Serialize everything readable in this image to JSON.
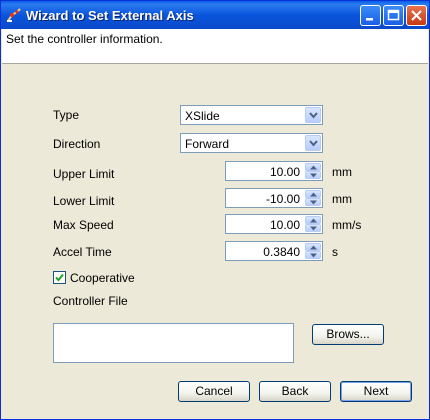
{
  "window": {
    "title": "Wizard to Set External Axis"
  },
  "info": {
    "text": "Set the controller information."
  },
  "form": {
    "type": {
      "label": "Type",
      "value": "XSlide"
    },
    "direction": {
      "label": "Direction",
      "value": "Forward"
    },
    "upper_limit": {
      "label": "Upper Limit",
      "value": "10.00",
      "unit": "mm"
    },
    "lower_limit": {
      "label": "Lower Limit",
      "value": "-10.00",
      "unit": "mm"
    },
    "max_speed": {
      "label": "Max Speed",
      "value": "10.00",
      "unit": "mm/s"
    },
    "accel_time": {
      "label": "Accel Time",
      "value": "0.3840",
      "unit": "s"
    },
    "cooperative": {
      "label": "Cooperative",
      "checked": true
    },
    "controller_file": {
      "label": "Controller File",
      "value": ""
    }
  },
  "buttons": {
    "browse": "Brows...",
    "cancel": "Cancel",
    "back": "Back",
    "next": "Next"
  },
  "colors": {
    "titlebar": "#0a55dd",
    "dialog_bg": "#ece9d8",
    "close_button": "#c63a14"
  }
}
